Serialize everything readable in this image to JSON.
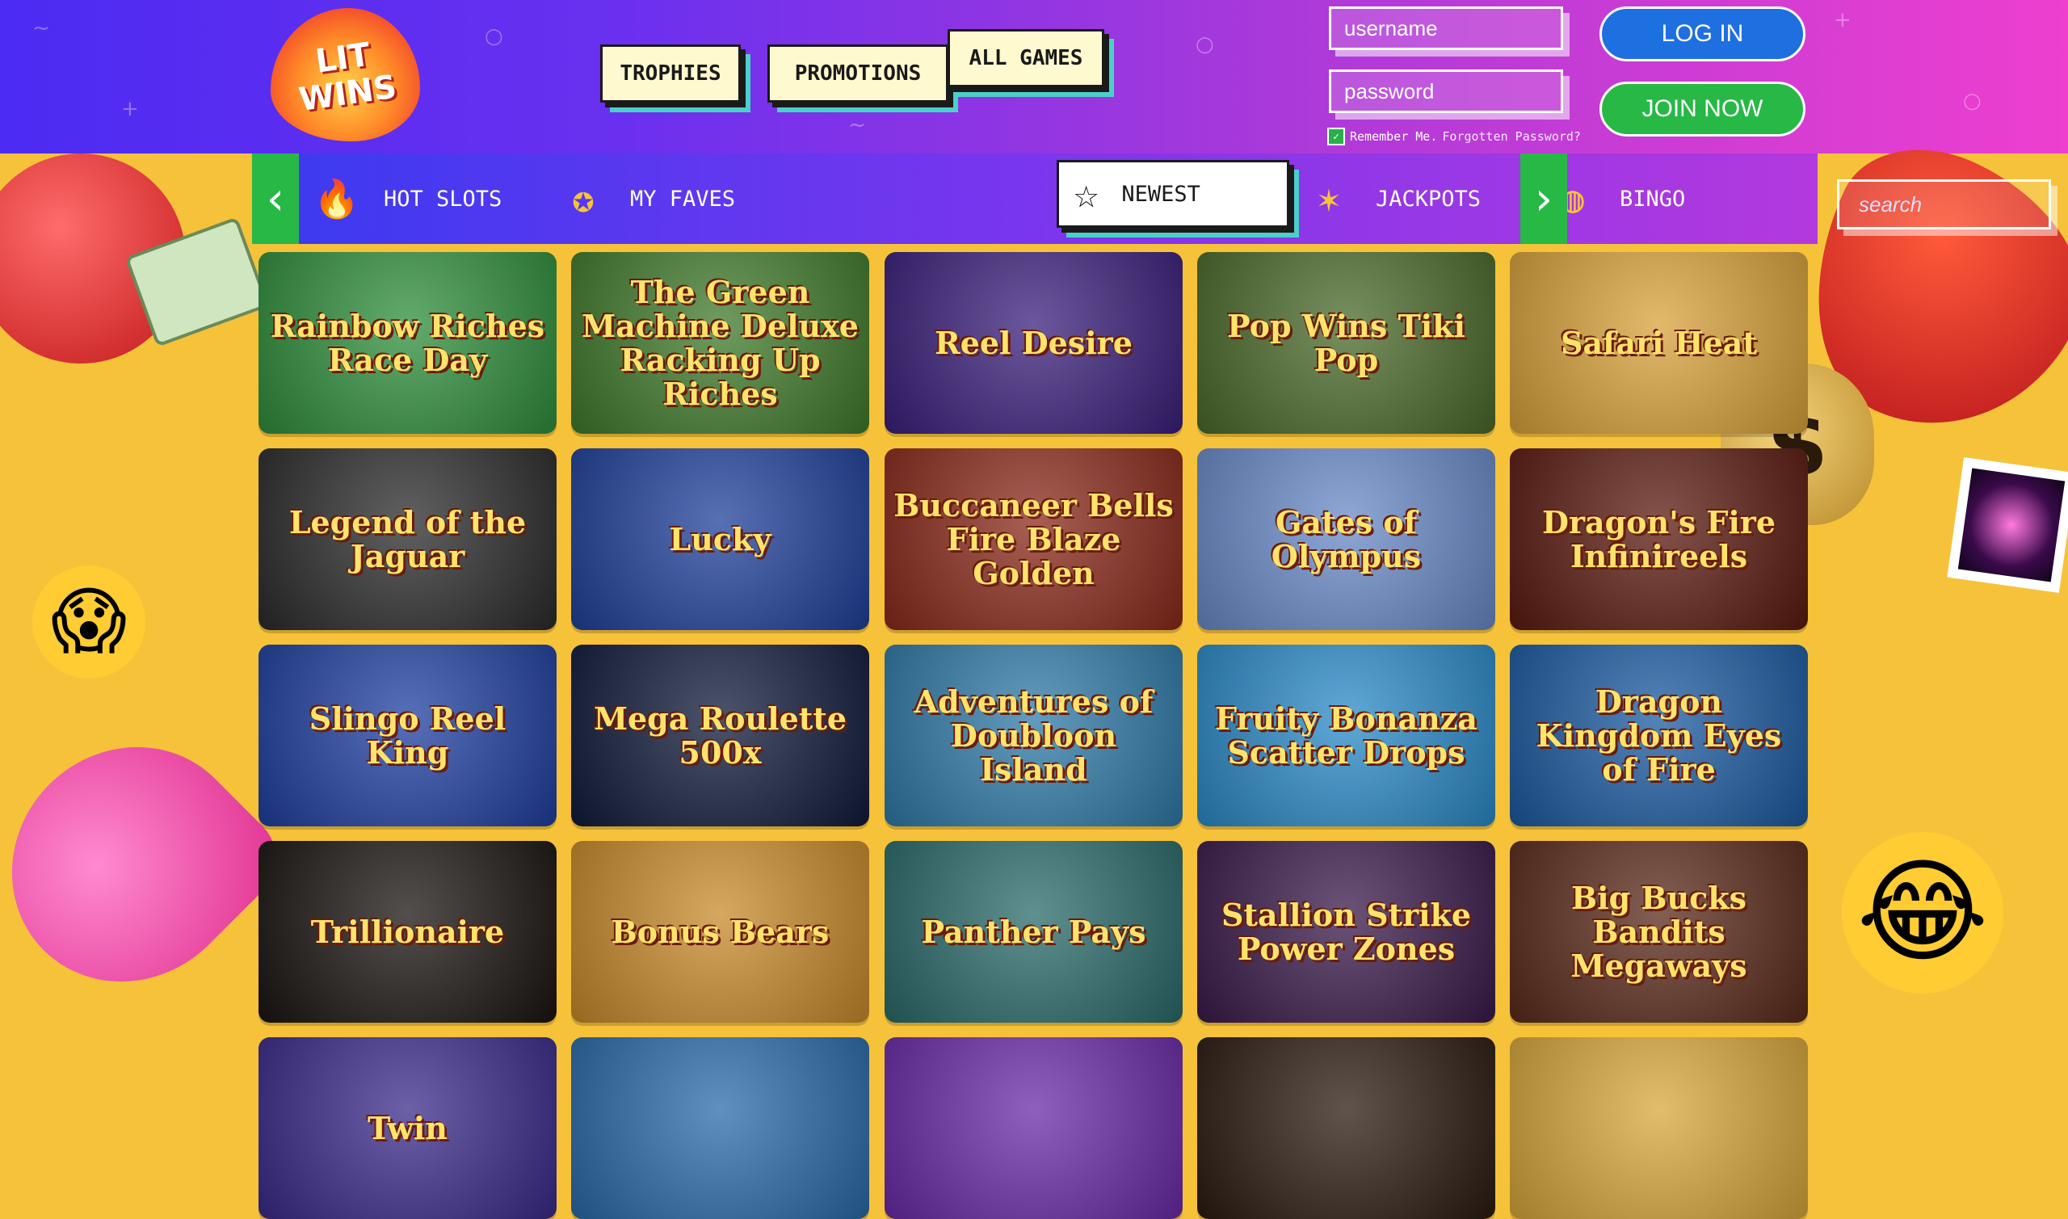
{
  "brand": {
    "logo_text": "LIT WINS"
  },
  "header": {
    "nav": [
      "TROPHIES",
      "PROMOTIONS",
      "ALL GAMES"
    ],
    "username_placeholder": "username",
    "password_placeholder": "password",
    "login_label": "LOG IN",
    "join_label": "JOIN NOW",
    "remember_label": "Remember Me.",
    "forgot_label": "Forgotten Password?"
  },
  "categories": {
    "items": [
      {
        "label": "HOT SLOTS",
        "icon": "flame-icon"
      },
      {
        "label": "MY FAVES",
        "icon": "rosette-icon"
      },
      {
        "label": "NEWEST",
        "icon": "star-icon",
        "active": true
      },
      {
        "label": "JACKPOTS",
        "icon": "sevens-icon"
      },
      {
        "label": "BINGO",
        "icon": "globe-icon"
      }
    ],
    "search_placeholder": "search"
  },
  "games": [
    {
      "title": "Rainbow Riches Race Day",
      "color": "#2f8f3c"
    },
    {
      "title": "The Green Machine Deluxe Racking Up Riches",
      "color": "#3f7a2a"
    },
    {
      "title": "Reel Desire",
      "color": "#3a1f7a"
    },
    {
      "title": "Pop Wins Tiki Pop",
      "color": "#4a6a2a"
    },
    {
      "title": "Safari Heat",
      "color": "#d9a13a"
    },
    {
      "title": "Legend of the Jaguar",
      "color": "#2b2b2b"
    },
    {
      "title": "Lucky",
      "color": "#1f3f9a"
    },
    {
      "title": "Buccaneer Bells Fire Blaze Golden",
      "color": "#8a2a1a"
    },
    {
      "title": "Gates of Olympus",
      "color": "#6a8ac8"
    },
    {
      "title": "Dragon's Fire Infinireels",
      "color": "#5a1a10"
    },
    {
      "title": "Slingo Reel King",
      "color": "#1f3fa0"
    },
    {
      "title": "Mega Roulette 500x",
      "color": "#101a3a"
    },
    {
      "title": "Adventures of Doubloon Island",
      "color": "#2f7aa8"
    },
    {
      "title": "Fruity Bonanza Scatter Drops",
      "color": "#2a8ac8"
    },
    {
      "title": "Dragon Kingdom Eyes of Fire",
      "color": "#1a5aa0"
    },
    {
      "title": "Trillionaire",
      "color": "#1a1410"
    },
    {
      "title": "Bonus Bears",
      "color": "#c88a2a"
    },
    {
      "title": "Panther Pays",
      "color": "#2a6a6a"
    },
    {
      "title": "Stallion Strike Power Zones",
      "color": "#3a1a4a"
    },
    {
      "title": "Big Bucks Bandits Megaways",
      "color": "#5a2a1a"
    },
    {
      "title": "Twin",
      "color": "#3a2a8a"
    },
    {
      "title": "",
      "color": "#2a6aa8"
    },
    {
      "title": "",
      "color": "#6a2aa8"
    },
    {
      "title": "",
      "color": "#2a1a10"
    },
    {
      "title": "",
      "color": "#d8a83a"
    }
  ],
  "colors": {
    "header_start": "#4c2bf2",
    "header_end": "#ee3fcf",
    "background": "#f6c23a",
    "green": "#27b845",
    "blue": "#1e6fe0"
  }
}
